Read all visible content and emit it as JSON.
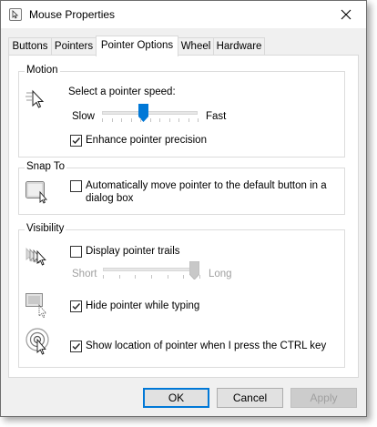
{
  "window": {
    "title": "Mouse Properties"
  },
  "tabs": [
    {
      "label": "Buttons"
    },
    {
      "label": "Pointers"
    },
    {
      "label": "Pointer Options"
    },
    {
      "label": "Wheel"
    },
    {
      "label": "Hardware"
    }
  ],
  "motion": {
    "label": "Motion",
    "prompt": "Select a pointer speed:",
    "slow_label": "Slow",
    "fast_label": "Fast",
    "speed_fraction": 0.43,
    "enhance": {
      "label": "Enhance pointer precision",
      "checked": true
    }
  },
  "snap_to": {
    "label": "Snap To",
    "option_line1": "Automatically move pointer to the default button in a",
    "option_line2": "dialog box",
    "checked": false
  },
  "visibility": {
    "label": "Visibility",
    "trails": {
      "label": "Display pointer trails",
      "checked": false
    },
    "short_label": "Short",
    "long_label": "Long",
    "trail_fraction": 0.95,
    "hide_typing": {
      "label": "Hide pointer while typing",
      "checked": true
    },
    "show_location": {
      "label": "Show location of pointer when I press the CTRL key",
      "checked": true
    }
  },
  "buttons": {
    "ok": "OK",
    "cancel": "Cancel",
    "apply": "Apply"
  },
  "colors": {
    "accent": "#0078d7",
    "disabled_text": "#a0a0a0"
  }
}
